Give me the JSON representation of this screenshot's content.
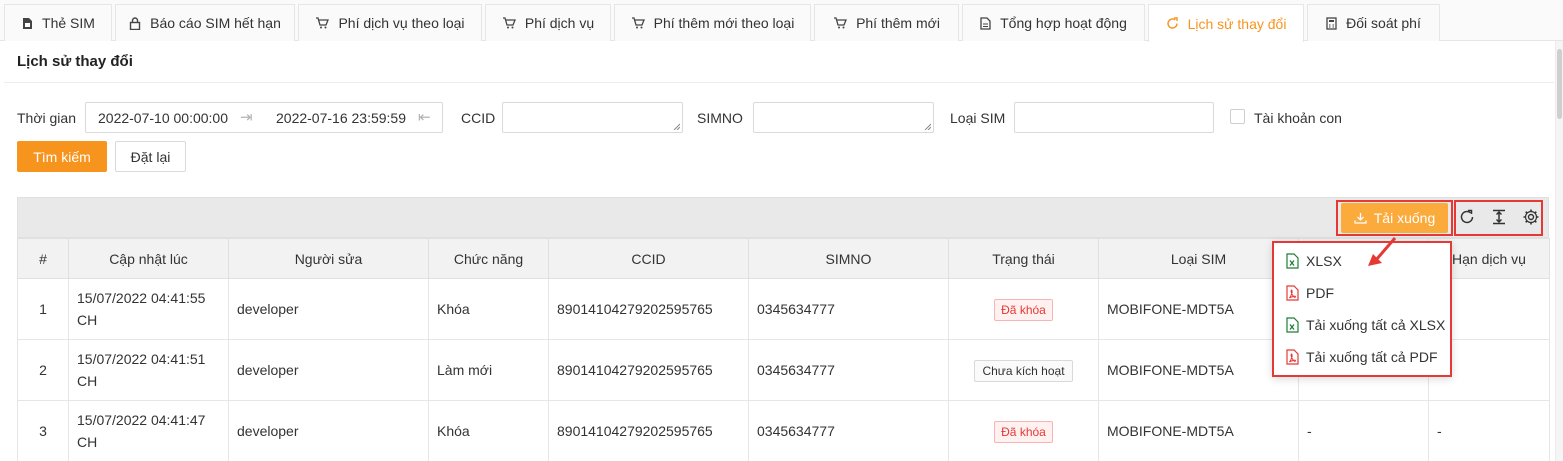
{
  "tabs": [
    {
      "label": "Thẻ SIM",
      "icon": "sim-card-icon"
    },
    {
      "label": "Báo cáo SIM hết hạn",
      "icon": "lock-icon"
    },
    {
      "label": "Phí dịch vụ theo loại",
      "icon": "cart-icon"
    },
    {
      "label": "Phí dịch vụ",
      "icon": "cart-icon"
    },
    {
      "label": "Phí thêm mới theo loại",
      "icon": "cart-icon"
    },
    {
      "label": "Phí thêm mới",
      "icon": "cart-icon"
    },
    {
      "label": "Tổng hợp hoạt động",
      "icon": "document-icon"
    },
    {
      "label": "Lịch sử thay đổi",
      "icon": "refresh-icon",
      "active": true
    },
    {
      "label": "Đối soát phí",
      "icon": "calculator-icon"
    }
  ],
  "page": {
    "title": "Lịch sử thay đổi"
  },
  "filters": {
    "time_label": "Thời gian",
    "date_from": "2022-07-10 00:00:00",
    "date_to": "2022-07-16 23:59:59",
    "ccid_label": "CCID",
    "ccid_value": "",
    "simno_label": "SIMNO",
    "simno_value": "",
    "sim_type_label": "Loại SIM",
    "sim_type_value": "",
    "sub_account_label": "Tài khoản con",
    "sub_account_checked": false
  },
  "buttons": {
    "search": "Tìm kiếm",
    "reset": "Đặt lại",
    "download": "Tải xuống"
  },
  "toolbar_icons": [
    "reload-icon",
    "column-height-icon",
    "settings-icon"
  ],
  "table": {
    "columns": [
      "#",
      "Cập nhật lúc",
      "Người sửa",
      "Chức năng",
      "CCID",
      "SIMNO",
      "Trạng thái",
      "Loại SIM",
      "",
      "Hạn dịch vụ"
    ],
    "rows": [
      {
        "no": "1",
        "updated_at": "15/07/2022 04:41:55 CH",
        "editor": "developer",
        "function": "Khóa",
        "ccid": "89014104279202595765",
        "simno": "0345634777",
        "status": "Đã khóa",
        "status_type": "locked",
        "sim_type": "MOBIFONE-MDT5A",
        "col9": "",
        "expiry": ""
      },
      {
        "no": "2",
        "updated_at": "15/07/2022 04:41:51 CH",
        "editor": "developer",
        "function": "Làm mới",
        "ccid": "89014104279202595765",
        "simno": "0345634777",
        "status": "Chưa kích hoạt",
        "status_type": "inactive",
        "sim_type": "MOBIFONE-MDT5A",
        "col9": "",
        "expiry": ""
      },
      {
        "no": "3",
        "updated_at": "15/07/2022 04:41:47 CH",
        "editor": "developer",
        "function": "Khóa",
        "ccid": "89014104279202595765",
        "simno": "0345634777",
        "status": "Đã khóa",
        "status_type": "locked",
        "sim_type": "MOBIFONE-MDT5A",
        "col9": "-",
        "expiry": "-"
      }
    ]
  },
  "download_menu": [
    {
      "label": "XLSX",
      "icon": "excel-file-icon"
    },
    {
      "label": "PDF",
      "icon": "pdf-file-icon"
    },
    {
      "label": "Tải xuống tất cả XLSX",
      "icon": "excel-file-icon"
    },
    {
      "label": "Tải xuống tất cả PDF",
      "icon": "pdf-file-icon"
    }
  ],
  "colors": {
    "accent": "#f7941d",
    "download_button": "#fbaa3c",
    "highlight": "#e53935",
    "excel_green": "#1e7e34",
    "pdf_red": "#e53935"
  }
}
